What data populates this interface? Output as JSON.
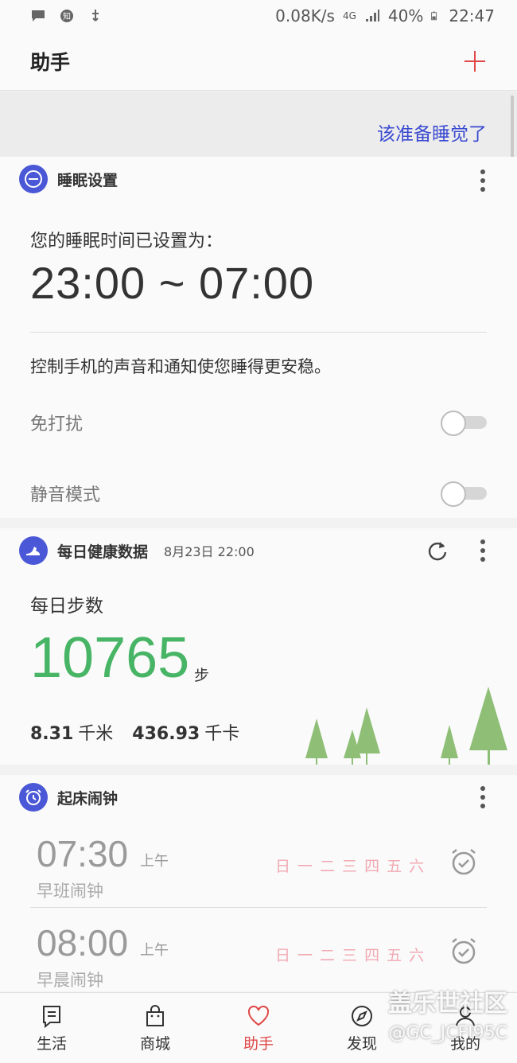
{
  "status_bar": {
    "left_icons": [
      "message-icon",
      "zhihu-icon",
      "usb-debug-icon"
    ],
    "network_speed": "0.08K/s",
    "network_type": "4G",
    "battery": "40%",
    "time": "22:47"
  },
  "header": {
    "title": "助手",
    "add_icon": "plus-icon"
  },
  "banner": {
    "link_text": "该准备睡觉了"
  },
  "sleep_card": {
    "title": "睡眠设置",
    "label": "您的睡眠时间已设置为：",
    "time_range": "23:00 ~ 07:00",
    "description": "控制手机的声音和通知使您睡得更安稳。",
    "toggles": [
      {
        "label": "免打扰",
        "state": "off"
      },
      {
        "label": "静音模式",
        "state": "off"
      }
    ]
  },
  "health_card": {
    "title": "每日健康数据",
    "timestamp": "8月23日 22:00",
    "steps_label": "每日步数",
    "steps_value": "10765",
    "steps_unit": "步",
    "distance_value": "8.31",
    "distance_unit": "千米",
    "calories_value": "436.93",
    "calories_unit": "千卡"
  },
  "alarm_card": {
    "title": "起床闹钟",
    "alarms": [
      {
        "time": "07:30",
        "ampm": "上午",
        "name": "早班闹钟",
        "days": [
          "日",
          "一",
          "二",
          "三",
          "四",
          "五",
          "六"
        ]
      },
      {
        "time": "08:00",
        "ampm": "上午",
        "name": "早晨闹钟",
        "days": [
          "日",
          "一",
          "二",
          "三",
          "四",
          "五",
          "六"
        ]
      }
    ]
  },
  "bottom_nav": {
    "items": [
      {
        "label": "生活",
        "icon": "life-icon",
        "active": false
      },
      {
        "label": "商城",
        "icon": "shop-bag-icon",
        "active": false
      },
      {
        "label": "助手",
        "icon": "heart-icon",
        "active": true
      },
      {
        "label": "发现",
        "icon": "compass-icon",
        "active": false
      },
      {
        "label": "我的",
        "icon": "profile-icon",
        "active": false
      }
    ]
  },
  "watermark": {
    "line1": "盖乐世社区",
    "line2": "@GC_JCFI95C"
  },
  "colors": {
    "accent_red": "#e04848",
    "link_blue": "#3b4bd1",
    "icon_blue": "#4a57d6",
    "steps_green": "#47b565",
    "days_pink": "#f2a9b3"
  }
}
